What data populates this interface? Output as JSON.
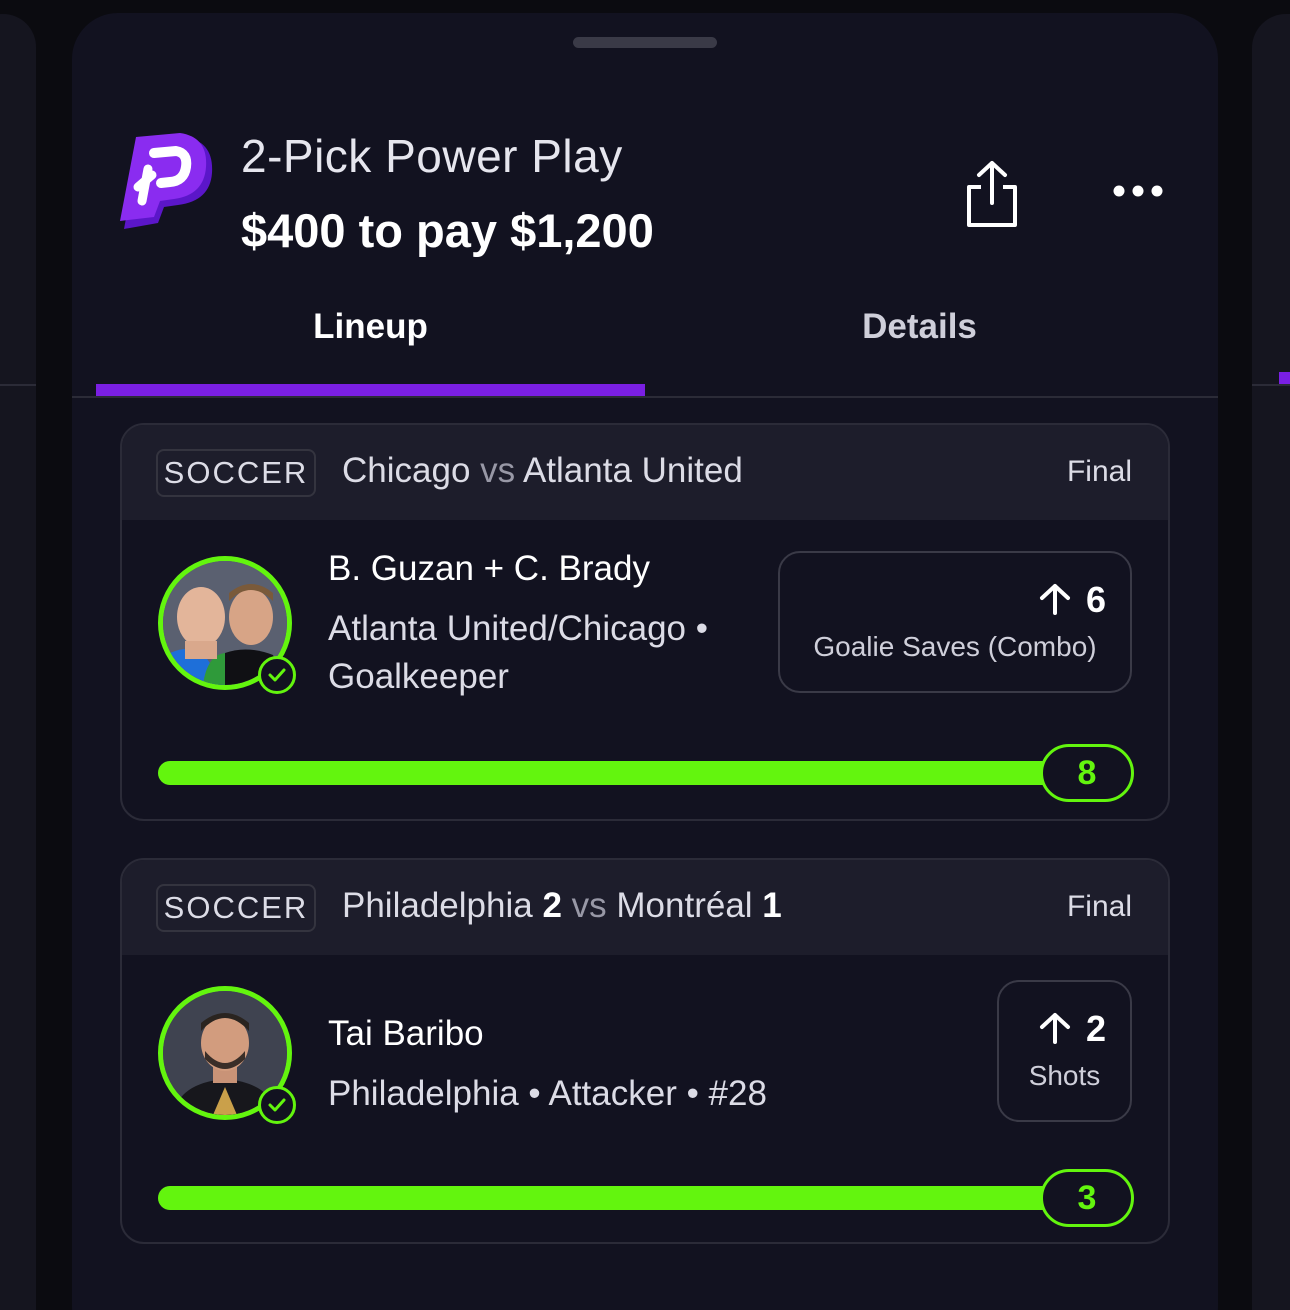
{
  "header": {
    "title": "2-Pick Power Play",
    "subtitle": "$400 to pay $1,200",
    "logo_icon": "prizepicks-logo-icon",
    "share_icon": "share-icon",
    "more_icon": "more-dots-icon"
  },
  "tabs": [
    {
      "label": "Lineup",
      "active": true
    },
    {
      "label": "Details",
      "active": false
    }
  ],
  "colors": {
    "accent": "#7a1fe3",
    "win_green": "#63f50e",
    "background": "#121220",
    "card_header": "#1d1d2b"
  },
  "picks": [
    {
      "sport": "SOCCER",
      "team1": "Chicago",
      "team1_score": "",
      "vs": "vs",
      "team2": "Atlanta United",
      "team2_score": "",
      "status": "Final",
      "player_name": "B. Guzan + C. Brady",
      "player_meta": "Atlanta United/Chicago • Goalkeeper",
      "direction_icon": "arrow-up-icon",
      "line": "6",
      "stat": "Goalie Saves (Combo)",
      "result": "8",
      "progress_fraction": 1.0,
      "check_icon": "check-circle-icon"
    },
    {
      "sport": "SOCCER",
      "team1": "Philadelphia",
      "team1_score": "2",
      "vs": "vs",
      "team2": "Montréal",
      "team2_score": "1",
      "status": "Final",
      "player_name": "Tai Baribo",
      "player_meta": "Philadelphia • Attacker • #28",
      "direction_icon": "arrow-up-icon",
      "line": "2",
      "stat": "Shots",
      "result": "3",
      "progress_fraction": 1.0,
      "check_icon": "check-circle-icon"
    }
  ]
}
